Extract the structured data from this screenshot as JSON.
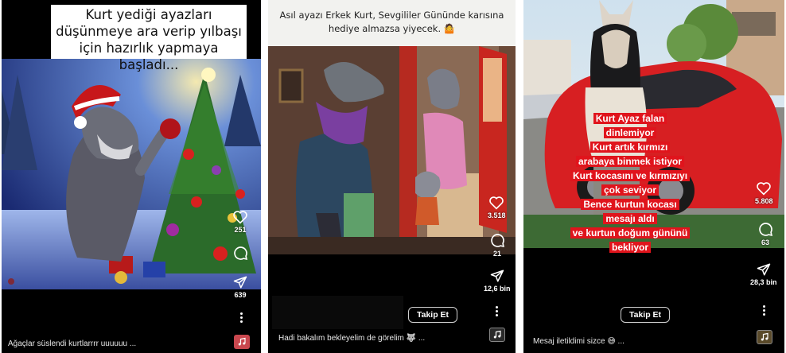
{
  "panels": [
    {
      "caption": [
        "Kurt yediği ayazları",
        "düşünmeye ara verip yılbaşı",
        "için hazırlık yapmaya başladı..."
      ],
      "likes": "251",
      "comments": "",
      "shares": "639",
      "description": "Ağaçlar süslendi kurtlarrrr uuuuuu ..."
    },
    {
      "caption": [
        "Asıl ayazı Erkek Kurt, Sevgililer Gününde karısına",
        "hediye almazsa yiyecek. 🤷"
      ],
      "likes": "3.518",
      "comments": "21",
      "shares": "12,6 bin",
      "follow": "Takip Et",
      "description": "Hadi bakalım bekleyelim de görelim 🐺 ..."
    },
    {
      "overlay": [
        "Kurt Ayaz falan",
        "dinlemiyor",
        "Kurt artık kırmızı",
        "arabaya binmek istiyor",
        "Kurt kocasını ve kırmızıyı",
        "çok seviyor",
        "Bence kurtun kocası",
        "mesajı aldı",
        "ve kurtun doğum gününü",
        "bekliyor"
      ],
      "likes": "5.808",
      "comments": "63",
      "shares": "28,3 bin",
      "follow": "Takip Et",
      "description": "Mesaj iletildimi sizce 😅 ..."
    }
  ],
  "icons": {
    "like": "heart-icon",
    "comment": "comment-icon",
    "share": "send-icon",
    "more": "more-vertical-icon",
    "music": "music-note-icon"
  }
}
